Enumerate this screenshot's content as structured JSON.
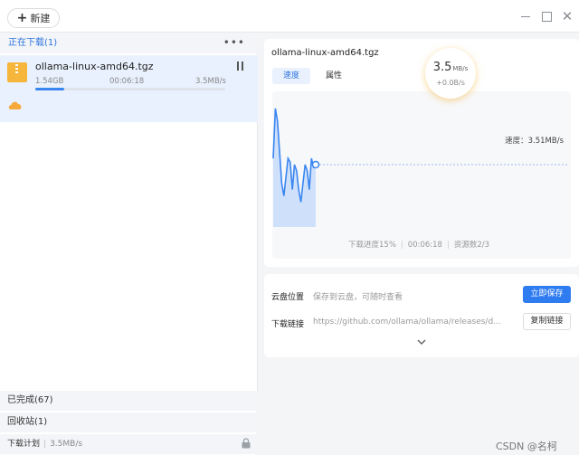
{
  "toolbar": {
    "new_label": "新建"
  },
  "sidebar": {
    "downloading_header": "正在下载(1)",
    "item": {
      "name": "ollama-linux-amd64.tgz",
      "size": "1.54GB",
      "time": "00:06:18",
      "speed": "3.5MB/s",
      "progress": 0.15
    },
    "completed": "已完成(67)",
    "trash": "回收站(1)",
    "plan_label": "下载计划",
    "plan_value": "3.5MB/s"
  },
  "detail": {
    "file_name": "ollama-linux-amd64.tgz",
    "tabs": [
      "速度",
      "属性"
    ],
    "bubble": {
      "value": "3.5",
      "unit": "MB/s",
      "delta": "+0.0B/s"
    },
    "speed_line_label": "速度：3.51MB/s",
    "stats": {
      "progress": "下载进度15%",
      "time": "00:06:18",
      "resources": "资源数2/3"
    },
    "chart_data": {
      "type": "area",
      "x": [
        0,
        1,
        2,
        3,
        4,
        5,
        6,
        7,
        8,
        9,
        10,
        11,
        12,
        13,
        14,
        15,
        16,
        17,
        18,
        19,
        20
      ],
      "y": [
        0.55,
        0.95,
        0.85,
        0.6,
        0.35,
        0.25,
        0.4,
        0.55,
        0.52,
        0.3,
        0.5,
        0.45,
        0.3,
        0.2,
        0.35,
        0.5,
        0.45,
        0.3,
        0.55,
        0.48,
        0.5
      ],
      "current": 0.5
    }
  },
  "cloud": {
    "location_label": "云盘位置",
    "location_value": "保存到云盘，可随时查看",
    "save_button": "立即保存",
    "link_label": "下载链接",
    "link_value": "https://github.com/ollama/ollama/releases/d...",
    "copy_button": "复制链接"
  },
  "watermark": "CSDN @名柯",
  "colors": {
    "accent": "#2f7bf0",
    "zip": "#f6b63b",
    "chart_fill": "#cfe0fb",
    "chart_line": "#3a86f0"
  }
}
